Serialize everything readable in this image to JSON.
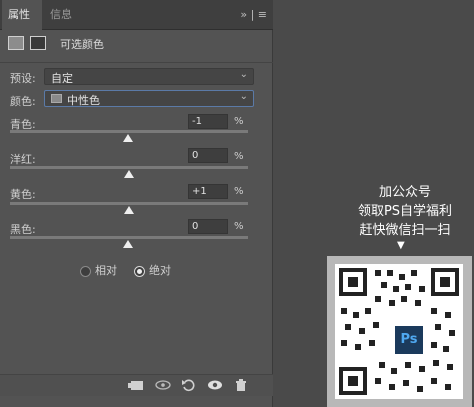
{
  "tabs": {
    "active": "属性",
    "inactive": "信息"
  },
  "tab_icons": "» | ≡",
  "header": {
    "title": "可选颜色"
  },
  "preset": {
    "label": "预设:",
    "value": "自定",
    "arrow": "⌄"
  },
  "color": {
    "label": "颜色:",
    "value": "中性色",
    "arrow": "⌄"
  },
  "sliders": [
    {
      "label": "青色:",
      "value": "-1",
      "unit": "%"
    },
    {
      "label": "洋红:",
      "value": "0",
      "unit": "%"
    },
    {
      "label": "黄色:",
      "value": "+1",
      "unit": "%"
    },
    {
      "label": "黑色:",
      "value": "0",
      "unit": "%"
    }
  ],
  "method": {
    "relative": "相对",
    "absolute": "绝对",
    "selected": "absolute"
  },
  "bottom_icons": [
    "clip-to-layer-icon",
    "view-previous-state-icon",
    "reset-icon",
    "visibility-icon",
    "trash-icon"
  ],
  "promo": {
    "line1": "加公众号",
    "line2": "领取PS自学福利",
    "line3": "赶快微信扫一扫",
    "arrow": "▼"
  },
  "qr_logo": "Ps"
}
